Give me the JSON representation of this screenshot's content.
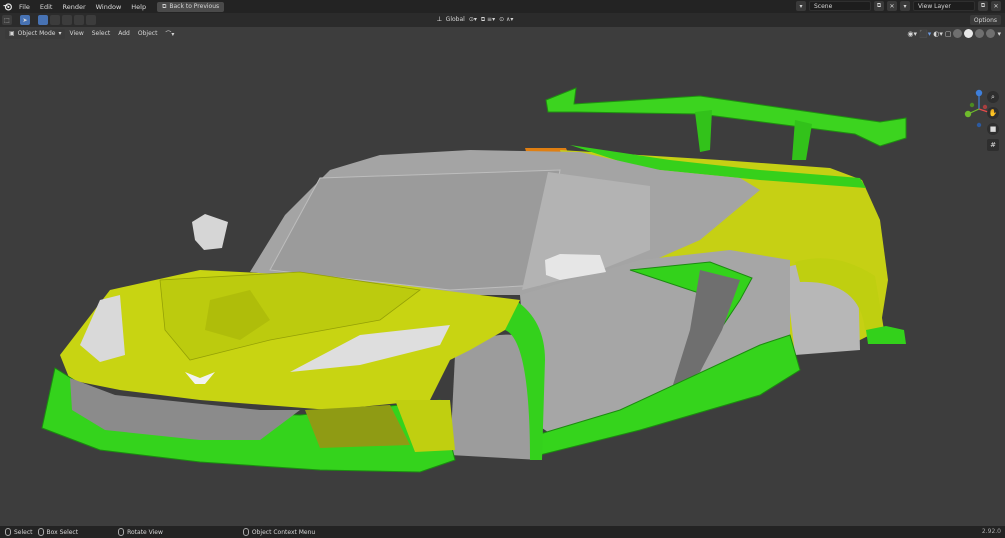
{
  "topbar": {
    "menus": [
      "File",
      "Edit",
      "Render",
      "Window",
      "Help"
    ],
    "back_button": "Back to Previous",
    "scene_label": "Scene",
    "view_layer_label": "View Layer"
  },
  "toolbar": {
    "transform_orientation": "Global",
    "options_label": "Options"
  },
  "header": {
    "mode": "Object Mode",
    "menus": [
      "View",
      "Select",
      "Add",
      "Object"
    ]
  },
  "gizmo": {
    "axes": [
      "X",
      "Y",
      "Z"
    ],
    "colors": {
      "x": "#e84a4a",
      "y": "#6fbb2c",
      "z": "#3e7fdb"
    }
  },
  "statusbar": {
    "select": "Select",
    "box_select": "Box Select",
    "rotate_view": "Rotate View",
    "context_menu": "Object Context Menu",
    "version": "2.92.0"
  },
  "colors": {
    "body_panels": "#bfcf10",
    "aero_parts": "#2fd61a",
    "stock_body": "#a6a6a6",
    "viewport_bg": "#3d3d3d"
  }
}
